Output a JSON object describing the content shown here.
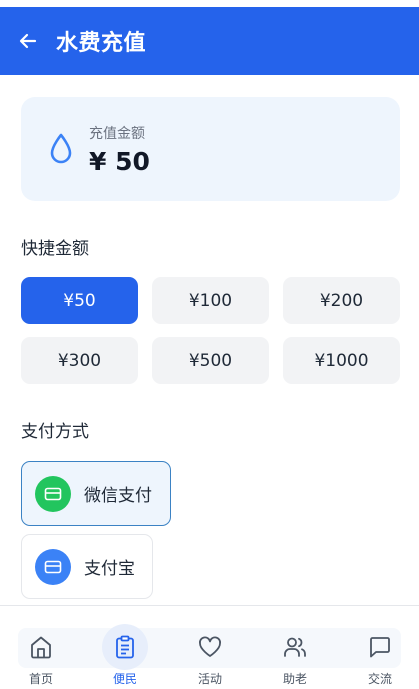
{
  "header": {
    "title": "水费充值",
    "back_icon": "arrow-left-icon"
  },
  "amount_card": {
    "label": "充值金额",
    "value": "¥ 50",
    "icon": "water-drop-icon"
  },
  "quick_amounts": {
    "title": "快捷金额",
    "options": [
      "¥50",
      "¥100",
      "¥200",
      "¥300",
      "¥500",
      "¥1000"
    ],
    "selected_index": 0
  },
  "payment": {
    "title": "支付方式",
    "methods": [
      {
        "label": "微信支付",
        "icon": "card-icon",
        "color": "#22c55e",
        "selected": true
      },
      {
        "label": "支付宝",
        "icon": "card-icon",
        "color": "#3b82f6",
        "selected": false
      }
    ]
  },
  "bottom_nav": {
    "items": [
      {
        "label": "首页",
        "icon": "home-icon"
      },
      {
        "label": "便民",
        "icon": "clipboard-icon",
        "active": true
      },
      {
        "label": "活动",
        "icon": "heart-icon"
      },
      {
        "label": "助老",
        "icon": "users-icon"
      },
      {
        "label": "交流",
        "icon": "chat-icon"
      }
    ]
  },
  "colors": {
    "primary": "#2563eb",
    "card_bg": "#eef5fd",
    "wechat_green": "#22c55e"
  }
}
